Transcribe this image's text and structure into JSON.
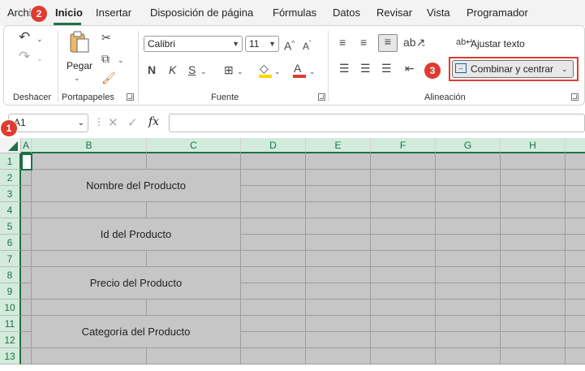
{
  "menu": {
    "tabs": [
      "Archivo",
      "Inicio",
      "Insertar",
      "Disposición de página",
      "Fórmulas",
      "Datos",
      "Revisar",
      "Vista",
      "Programador"
    ],
    "active_tab": "Inicio"
  },
  "ribbon": {
    "groups": {
      "undo": "Deshacer",
      "clipboard": "Portapapeles",
      "font": "Fuente",
      "alignment": "Alineación"
    },
    "paste_label": "Pegar",
    "font_name": "Calibri",
    "font_size": "11",
    "wrap_text_label": "Ajustar texto",
    "merge_center_label": "Combinar y centrar",
    "fill_color": "#ffd700",
    "font_color": "#e03b2f"
  },
  "callouts": {
    "one": "1",
    "two": "2",
    "three": "3",
    "color": "#e03b2f"
  },
  "formula_bar": {
    "name_box": "A1",
    "fx": "fx",
    "value": ""
  },
  "sheet": {
    "columns": [
      "A",
      "B",
      "C",
      "D",
      "E",
      "F",
      "G",
      "H"
    ],
    "rows": [
      "1",
      "2",
      "3",
      "4",
      "5",
      "6",
      "7",
      "8",
      "9",
      "10",
      "11",
      "12",
      "13"
    ],
    "merged_cells": [
      "Nombre del Producto",
      "Id del Producto",
      "Precio del Producto",
      "Categoría del Producto"
    ],
    "selection_fill": "#c6c6c6"
  }
}
